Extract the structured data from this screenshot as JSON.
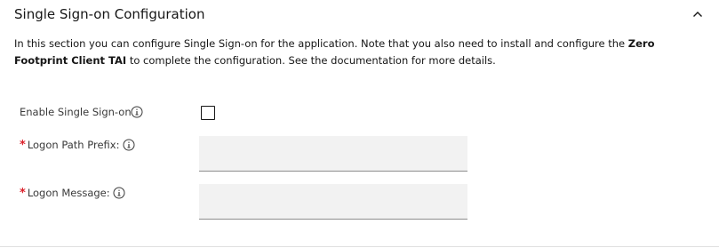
{
  "section": {
    "title": "Single Sign-on Configuration",
    "expanded": true,
    "description_before": "In this section you can configure Single Sign-on for the application. Note that you also need to install and configure the ",
    "description_bold": "Zero Footprint Client TAI",
    "description_after": " to complete the configuration. See the documentation for more details."
  },
  "fields": {
    "enable_sso": {
      "label": "Enable Single Sign-on",
      "checked": false
    },
    "logon_path_prefix": {
      "label": "Logon Path Prefix:",
      "required_marker": "*",
      "value": ""
    },
    "logon_message": {
      "label": "Logon Message:",
      "required_marker": "*",
      "value": ""
    }
  },
  "icons": {
    "collapse": "chevron-up-icon",
    "info": "information-icon"
  },
  "colors": {
    "text": "#161616",
    "label": "#393939",
    "required": "#da1e28",
    "input_background": "#f2f2f2",
    "input_border": "#8d8d8d"
  }
}
